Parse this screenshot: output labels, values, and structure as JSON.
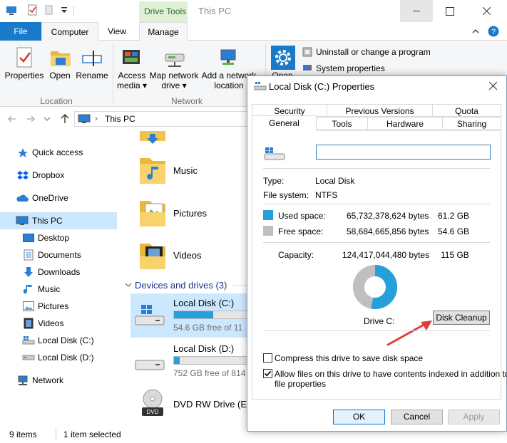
{
  "window": {
    "title": "This PC",
    "contextual_tab": "Drive Tools"
  },
  "ribbon": {
    "tabs": {
      "file": "File",
      "computer": "Computer",
      "view": "View",
      "manage": "Manage"
    },
    "location": {
      "properties": "Properties",
      "open": "Open",
      "rename": "Rename",
      "group": "Location"
    },
    "network": {
      "access_media_1": "Access",
      "access_media_2": "media",
      "map_drive_1": "Map network",
      "map_drive_2": "drive",
      "add_location_1": "Add a network",
      "add_location_2": "location",
      "group": "Network"
    },
    "system": {
      "open": "Open",
      "uninstall": "Uninstall or change a program",
      "system_properties": "System properties"
    }
  },
  "address": {
    "path": "This PC"
  },
  "nav": {
    "items": [
      {
        "label": "Quick access"
      },
      {
        "label": "Dropbox"
      },
      {
        "label": "OneDrive"
      },
      {
        "label": "This PC"
      },
      {
        "label": "Desktop"
      },
      {
        "label": "Documents"
      },
      {
        "label": "Downloads"
      },
      {
        "label": "Music"
      },
      {
        "label": "Pictures"
      },
      {
        "label": "Videos"
      },
      {
        "label": "Local Disk (C:)"
      },
      {
        "label": "Local Disk (D:)"
      },
      {
        "label": "Network"
      }
    ]
  },
  "content": {
    "folders": [
      {
        "label": "Music"
      },
      {
        "label": "Pictures"
      },
      {
        "label": "Videos"
      }
    ],
    "devices_header": "Devices and drives (3)",
    "drives": [
      {
        "name": "Local Disk (C:)",
        "free_text": "54.6 GB free of 11",
        "used_fraction": 0.53
      },
      {
        "name": "Local Disk (D:)",
        "free_text": "752 GB free of 814",
        "used_fraction": 0.08
      },
      {
        "name": "DVD RW Drive (E:)"
      }
    ]
  },
  "status": {
    "items": "9 items",
    "selected": "1 item selected"
  },
  "dialog": {
    "title": "Local Disk (C:) Properties",
    "tabs_row1": [
      "Security",
      "Previous Versions",
      "Quota"
    ],
    "tabs_row2": [
      "General",
      "Tools",
      "Hardware",
      "Sharing"
    ],
    "name_value": "",
    "type_label": "Type:",
    "type_value": "Local Disk",
    "fs_label": "File system:",
    "fs_value": "NTFS",
    "used": {
      "label": "Used space:",
      "bytes": "65,732,378,624 bytes",
      "size": "61.2 GB",
      "color": "#26a0da"
    },
    "free": {
      "label": "Free space:",
      "bytes": "58,684,665,856 bytes",
      "size": "54.6 GB",
      "color": "#bfbfbf"
    },
    "capacity": {
      "label": "Capacity:",
      "bytes": "124,417,044,480 bytes",
      "size": "115 GB"
    },
    "used_fraction": 0.5283,
    "drive_label": "Drive C:",
    "disk_cleanup": "Disk Cleanup",
    "compress_label": "Compress this drive to save disk space",
    "compress_checked": false,
    "index_label_1": "Allow files on this drive to have contents indexed in addition to",
    "index_label_2": "file properties",
    "index_checked": true,
    "ok": "OK",
    "cancel": "Cancel",
    "apply": "Apply"
  },
  "colors": {
    "accent": "#1979ca",
    "selection": "#cce8ff",
    "annotation_arrow": "#e03c3c"
  }
}
